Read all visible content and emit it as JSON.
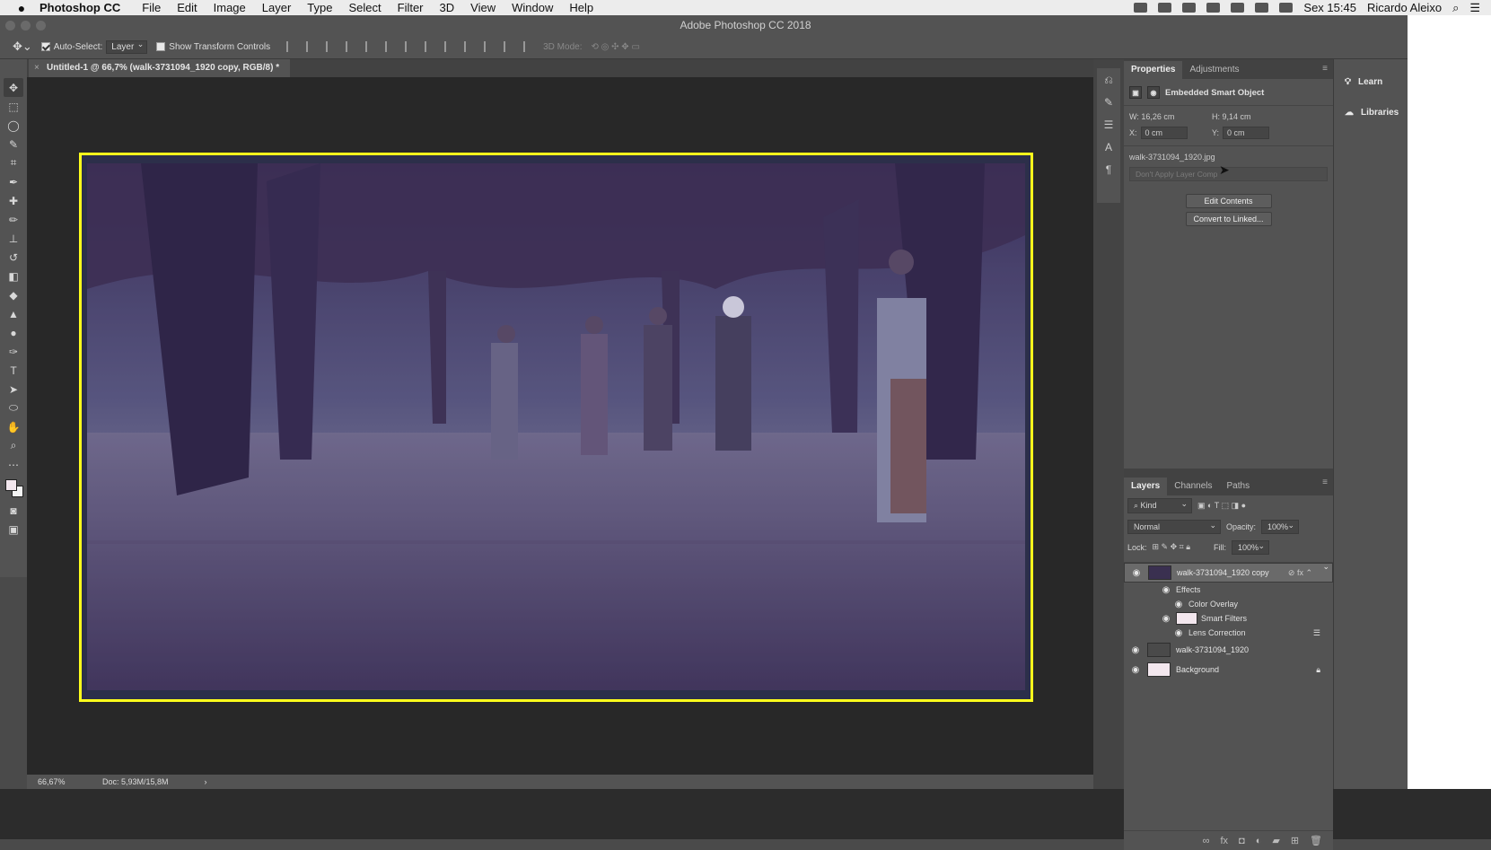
{
  "menubar": {
    "app_name": "Photoshop CC",
    "items": [
      "File",
      "Edit",
      "Image",
      "Layer",
      "Type",
      "Select",
      "Filter",
      "3D",
      "View",
      "Window",
      "Help"
    ],
    "clock": "Sex 15:45",
    "user": "Ricardo Aleixo"
  },
  "window": {
    "title": "Adobe Photoshop CC 2018"
  },
  "options_bar": {
    "auto_select_label": "Auto-Select:",
    "auto_select_value": "Layer",
    "transform_label": "Show Transform Controls",
    "mode_3d_label": "3D Mode:"
  },
  "document": {
    "tab_title": "Untitled-1 @ 66,7% (walk-3731094_1920 copy, RGB/8) *",
    "zoom": "66,67%",
    "doc_size": "Doc: 5,93M/15,8M"
  },
  "properties": {
    "tabs": [
      "Properties",
      "Adjustments"
    ],
    "type_label": "Embedded Smart Object",
    "w": "W: 16,26 cm",
    "h": "H: 9,14 cm",
    "x_label": "X:",
    "x_value": "0 cm",
    "y_label": "Y:",
    "y_value": "0 cm",
    "filename": "walk-3731094_1920.jpg",
    "layer_comp": "Don't Apply Layer Comp",
    "edit_button": "Edit Contents",
    "convert_button": "Convert to Linked..."
  },
  "layers_panel": {
    "tabs": [
      "Layers",
      "Channels",
      "Paths"
    ],
    "filter_kind": "Kind",
    "blend_mode": "Normal",
    "opacity_label": "Opacity:",
    "opacity_value": "100%",
    "lock_label": "Lock:",
    "fill_label": "Fill:",
    "fill_value": "100%",
    "layers": [
      {
        "name": "walk-3731094_1920 copy"
      },
      {
        "name": "Effects"
      },
      {
        "name": "Color Overlay"
      },
      {
        "name": "Smart Filters"
      },
      {
        "name": "Lens Correction"
      },
      {
        "name": "walk-3731094_1920"
      },
      {
        "name": "Background"
      }
    ]
  },
  "right_panel": {
    "learn": "Learn",
    "libraries": "Libraries"
  },
  "colors": {
    "selection_outline": "#ffff1c",
    "overlay_tint": "#4a3f78",
    "foreground": "#f3e7ee"
  }
}
